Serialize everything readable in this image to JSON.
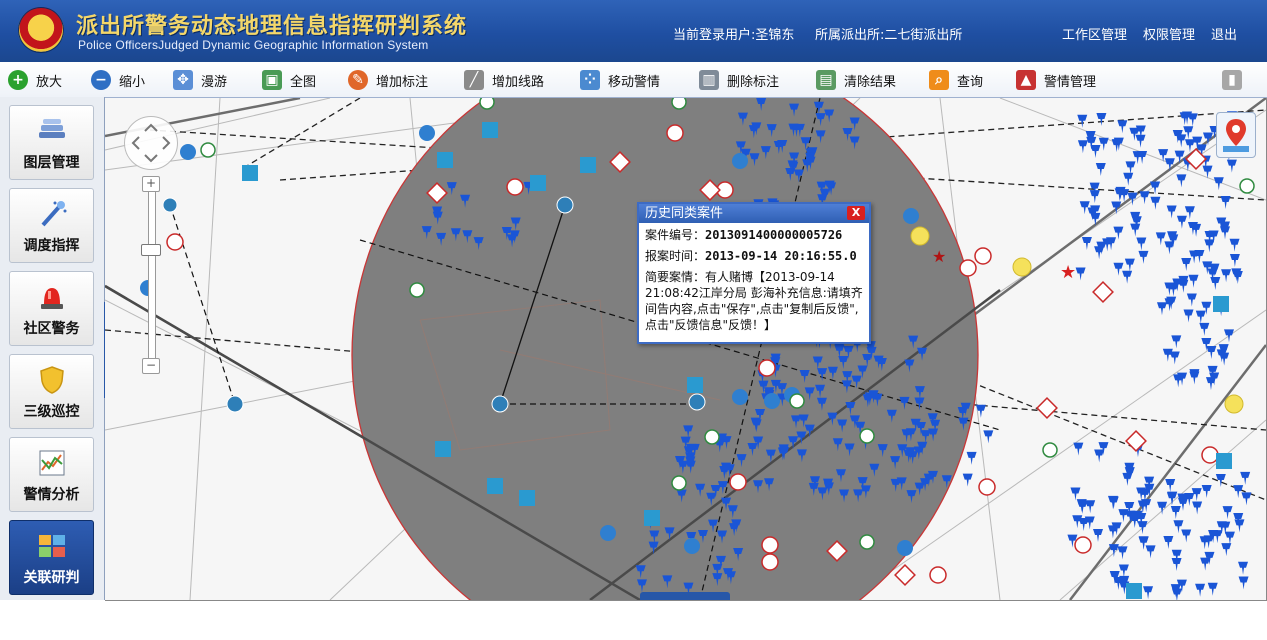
{
  "header": {
    "title_cn": "派出所警务动态地理信息指挥研判系统",
    "title_en": "Police OfficersJudged Dynamic Geographic Information System",
    "user_label": "当前登录用户:圣锦东",
    "station_label": "所属派出所:二七街派出所",
    "links": [
      "工作区管理",
      "权限管理",
      "退出"
    ]
  },
  "toolbar": {
    "items": [
      {
        "label": "放大",
        "icon": "zoom-in-icon",
        "color": "#2aa12e",
        "glyph": "+"
      },
      {
        "label": "缩小",
        "icon": "zoom-out-icon",
        "color": "#2f6fc4",
        "glyph": "−"
      },
      {
        "label": "漫游",
        "icon": "pan-icon",
        "color": "#5b8fd6",
        "glyph": "✥"
      },
      {
        "label": "全图",
        "icon": "full-map-icon",
        "color": "#4a9b55",
        "glyph": "▣"
      },
      {
        "label": "增加标注",
        "icon": "add-marker-icon",
        "color": "#e0672a",
        "glyph": "✎"
      },
      {
        "label": "增加线路",
        "icon": "add-route-icon",
        "color": "#8a8a8a",
        "glyph": "╱"
      },
      {
        "label": "移动警情",
        "icon": "move-alert-icon",
        "color": "#4b8ad0",
        "glyph": "⁘"
      },
      {
        "label": "删除标注",
        "icon": "delete-marker-icon",
        "color": "#7f8b98",
        "glyph": "▥"
      },
      {
        "label": "清除结果",
        "icon": "clear-results-icon",
        "color": "#5a9a62",
        "glyph": "▤"
      },
      {
        "label": "查询",
        "icon": "search-icon",
        "color": "#ef8c1a",
        "glyph": "⌕"
      },
      {
        "label": "警情管理",
        "icon": "alert-management-icon",
        "color": "#c73232",
        "glyph": "▲"
      }
    ]
  },
  "sidebar": {
    "items": [
      {
        "label": "图层管理",
        "icon": "layers-icon",
        "active": false
      },
      {
        "label": "调度指挥",
        "icon": "dispatch-wand-icon",
        "active": false
      },
      {
        "label": "社区警务",
        "icon": "siren-icon",
        "active": false
      },
      {
        "label": "三级巡控",
        "icon": "shield-icon",
        "active": false
      },
      {
        "label": "警情分析",
        "icon": "analysis-chart-icon",
        "active": false
      },
      {
        "label": "关联研判",
        "icon": "correlation-icon",
        "active": true
      }
    ]
  },
  "popup": {
    "title": "历史同类案件",
    "close_glyph": "X",
    "case_no_label": "案件编号：",
    "case_no": "2013091400000005726",
    "time_label": "报案时间：",
    "time": "2013-09-14 20:16:55.0",
    "desc_label": "简要案情：",
    "desc": "有人赌博【2013-09-14 21:08:42江岸分局 彭海补充信息:请填齐间告内容,点击\"保存\",点击\"复制后反馈\",点击\"反馈信息\"反馈！】"
  },
  "map_controls": {
    "zoom_in": "+",
    "zoom_out": "−"
  },
  "colors": {
    "header": "#1f4fa2",
    "title_gold": "#f4d76a",
    "buffer_circle": "#7f7f7f",
    "pin_blue": "#1a55d6",
    "alert_red": "#c92a2a"
  }
}
